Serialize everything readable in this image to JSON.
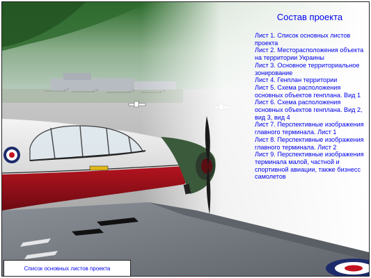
{
  "panel": {
    "title": "Состав проекта",
    "sheets": [
      "Лист 1. Список основных листов проекта",
      "Лист 2. Месторасположения объекта на территории Украины",
      "Лист 3. Основное территориальное зонирование",
      "Лист 4. Генплан территории",
      "Лист 5. Схема расположения основных объектов генплана. Вид 1",
      "Лист 6. Схема расположения основных объектов генплана. Вид 2, вид 3, вид 4",
      "Лист 7. Перспективные изображения главного терминала. Лист 1",
      "Лист 8. Перспективные изображения главного терминала. Лист 2",
      "Лист 9. Перспективные изображения терминала малой, частной и спортивной авиации, также бизнесс самолетов"
    ]
  },
  "caption": {
    "label": "Список основных листов проекта"
  },
  "colors": {
    "text_blue": "#0000ee",
    "fuselage_red": "#a8101c",
    "fuselage_white": "#e8e8e8",
    "nose_green": "#3b5a3b",
    "wing_gray": "#7a7f86"
  }
}
